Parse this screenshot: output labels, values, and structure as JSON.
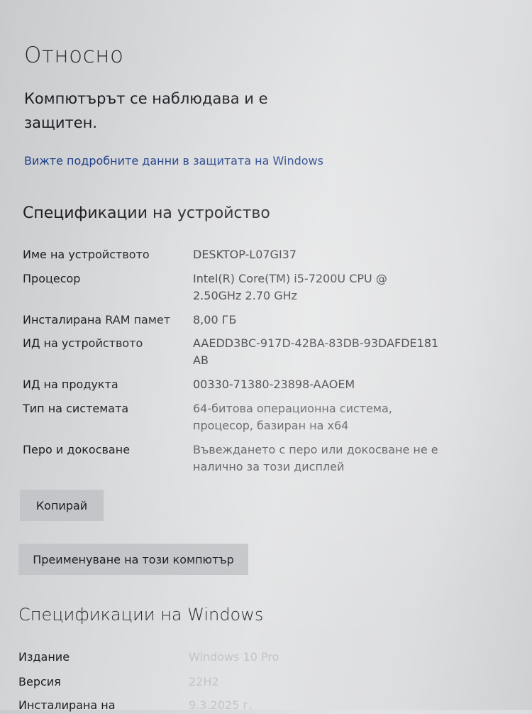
{
  "page": {
    "title": "Относно",
    "protection_text": "Компютърът се наблюдава и е защитен.",
    "security_link": "Вижте подробните данни в защитата на Windows"
  },
  "device_specs": {
    "title": "Спецификации на устройство",
    "rows": [
      {
        "label": "Име на устройството",
        "value": "DESKTOP-L07GI37"
      },
      {
        "label": "Процесор",
        "value": "Intel(R) Core(TM) i5-7200U CPU @ 2.50GHz   2.70 GHz"
      },
      {
        "label": "Инсталирана RAM памет",
        "value": "8,00 ГБ"
      },
      {
        "label": "ИД на устройството",
        "value": "AAEDD3BC-917D-42BA-83DB-93DAFDE181AB"
      },
      {
        "label": "ИД на продукта",
        "value": "00330-71380-23898-AAOEM"
      },
      {
        "label": "Тип на системата",
        "value": "64-битова операционна система, процесор, базиран на x64"
      },
      {
        "label": "Перо и докосване",
        "value": "Въвеждането с перо или докосване не е налично за този дисплей"
      }
    ],
    "copy_button": "Копирай",
    "rename_button": "Преименуване на този компютър"
  },
  "windows_specs": {
    "title": "Спецификации на Windows",
    "rows": [
      {
        "label": "Издание",
        "value": "Windows 10 Pro"
      },
      {
        "label": "Версия",
        "value": "22H2"
      },
      {
        "label": "Инсталирана на",
        "value": "9.3.2025 г."
      }
    ]
  },
  "colors": {
    "link": "#1f3f88",
    "button_bg": "#c4c5c8"
  }
}
